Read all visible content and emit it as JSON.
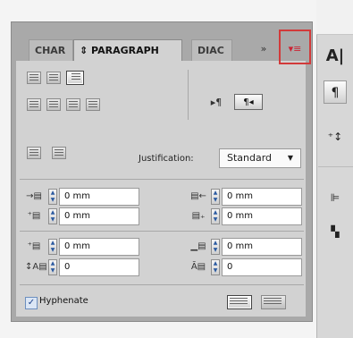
{
  "tabs": [
    {
      "label": "CHAR"
    },
    {
      "label": "⇕ PARAGRAPH"
    },
    {
      "label": "DIAC"
    }
  ],
  "panel_menu": {
    "forward_icon": "»",
    "menu_icon": "▾≡"
  },
  "alignment_icons": [
    "align-left-icon",
    "align-center-icon",
    "align-right-icon",
    "justify-left-icon",
    "justify-center-icon",
    "justify-right-icon",
    "justify-all-icon"
  ],
  "direction": {
    "ltr_icon": "▸¶",
    "rtl_label": "¶◂"
  },
  "justification": {
    "label": "Justification:",
    "value": "Standard"
  },
  "indents": {
    "left": "0 mm",
    "right": "0 mm",
    "first_line": "0 mm",
    "last_line": "0 mm"
  },
  "spacing": {
    "before": "0 mm",
    "after": "0 mm",
    "drop_cap_lines": "0",
    "drop_cap_chars": "0"
  },
  "hyphenate": {
    "label": "Hyphenate",
    "checked": true
  },
  "right_dock": {
    "icons": [
      "character-icon",
      "paragraph-icon",
      "kerning-icon",
      "align-icon",
      "transform-icon"
    ]
  }
}
